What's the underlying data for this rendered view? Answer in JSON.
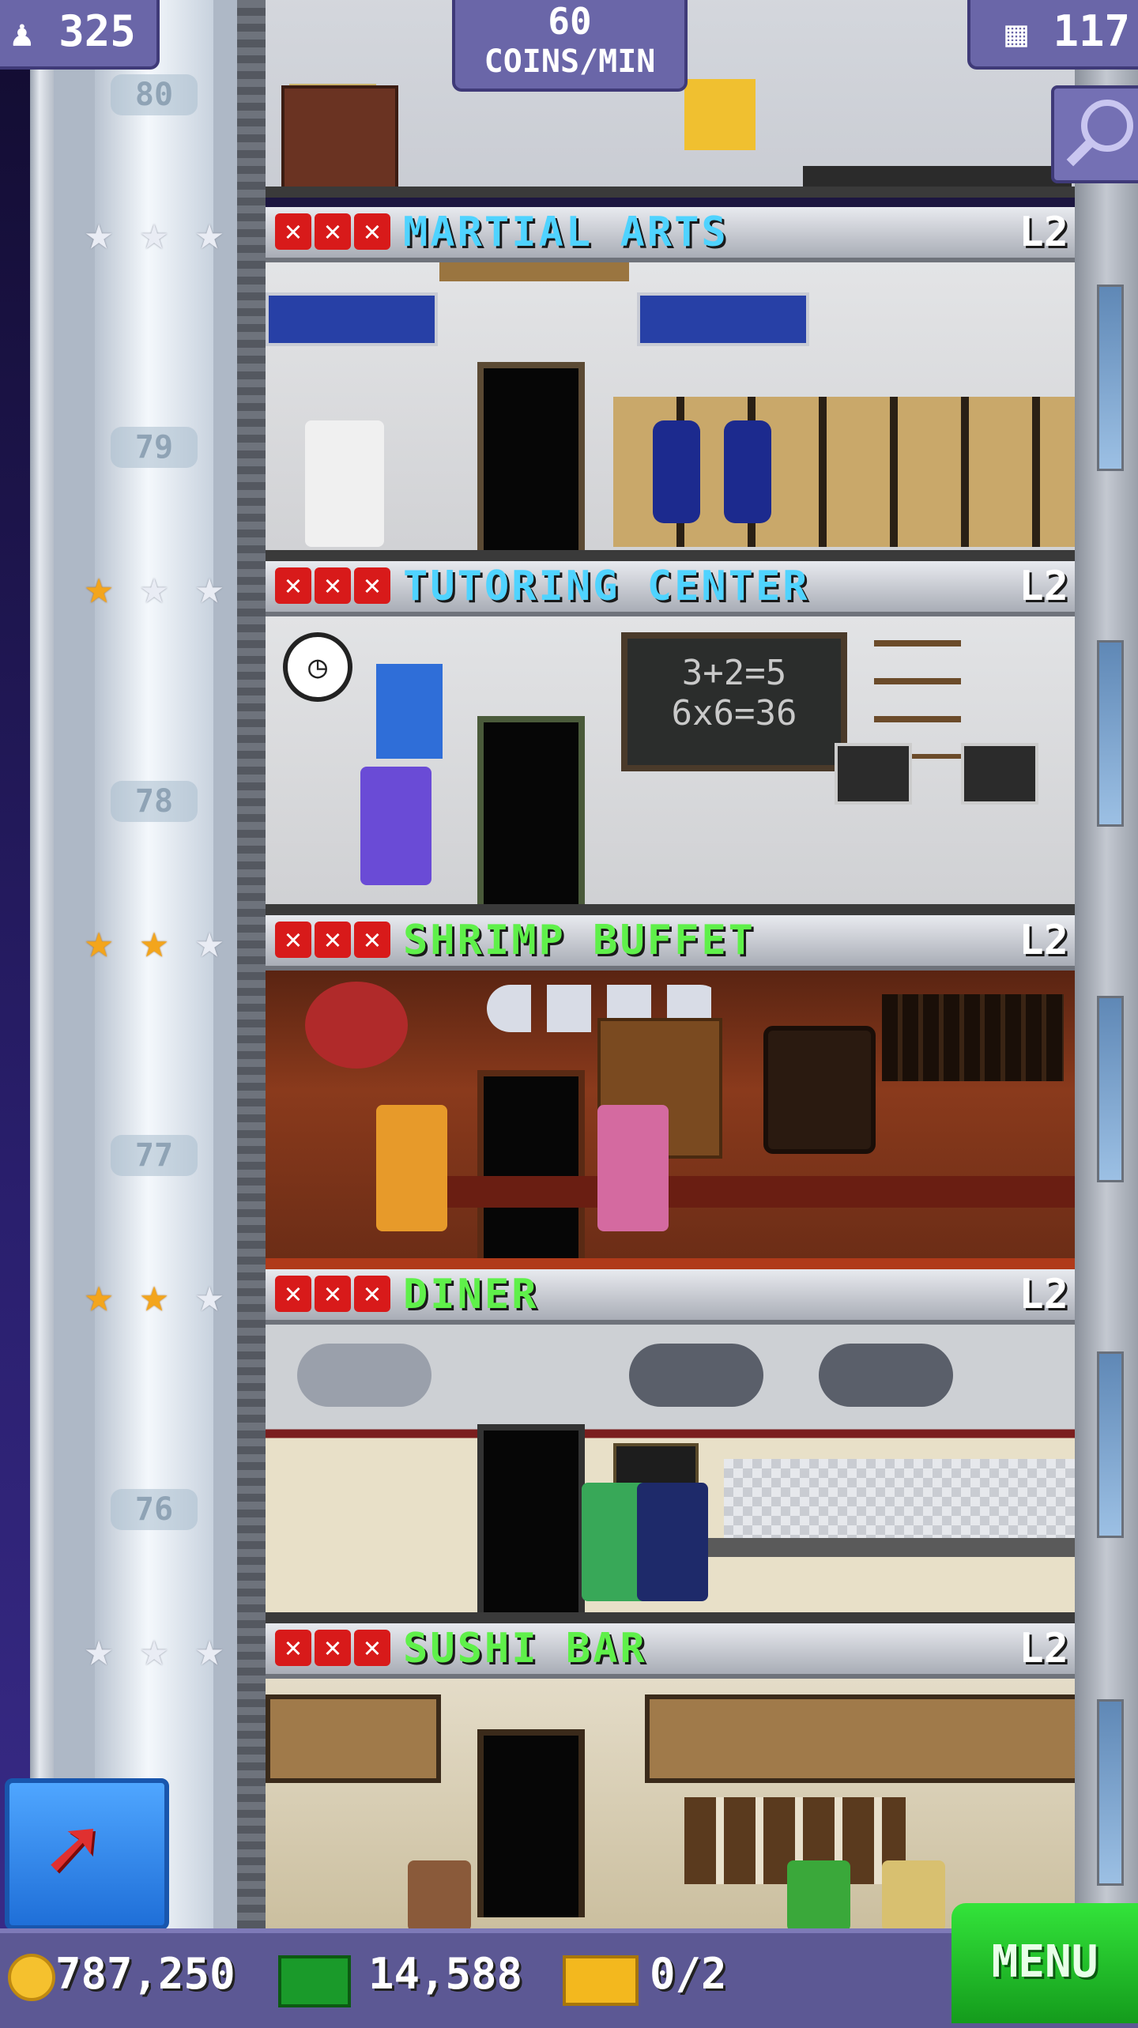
{
  "hud": {
    "population": "325",
    "coins_rate_line1": "60",
    "coins_rate_line2": "COINS/MIN",
    "floors_count": "117"
  },
  "floors": [
    {
      "floor_number": "80"
    },
    {
      "name": "MARTIAL ARTS",
      "level": "L2",
      "floor_number": "79",
      "stars": [
        "silver",
        "silver",
        "silver"
      ],
      "name_color": "#4fd3ff"
    },
    {
      "name": "TUTORING CENTER",
      "level": "L2",
      "floor_number": "78",
      "stars": [
        "gold",
        "silver",
        "silver"
      ],
      "name_color": "#4fd3ff",
      "blackboard_line1": "3+2=5",
      "blackboard_line2": "6x6=36"
    },
    {
      "name": "SHRIMP BUFFET",
      "level": "L2",
      "floor_number": "77",
      "stars": [
        "gold",
        "gold",
        "silver"
      ],
      "name_color": "#5ff04a"
    },
    {
      "name": "DINER",
      "level": "L2",
      "floor_number": "76",
      "stars": [
        "gold",
        "gold",
        "silver"
      ],
      "name_color": "#5ff04a"
    },
    {
      "name": "SUSHI BAR",
      "level": "L2",
      "stars": [
        "silver",
        "silver",
        "silver"
      ],
      "name_color": "#5ff04a"
    }
  ],
  "bottom": {
    "coins": "787,250",
    "bux": "14,588",
    "tickets": "0/2",
    "menu_label": "MENU"
  }
}
